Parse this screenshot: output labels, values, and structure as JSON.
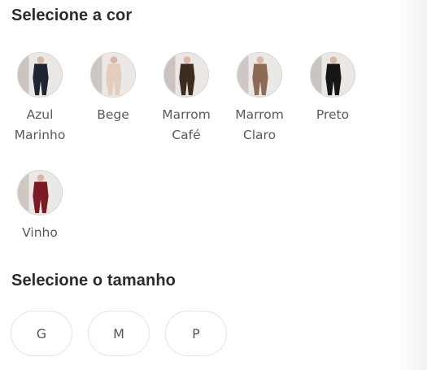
{
  "color_section": {
    "title": "Selecione a cor",
    "options": [
      {
        "label_line1": "Azul",
        "label_line2": "Marinho",
        "outfit_color": "#1e2530",
        "icon": "azul-marinho-outfit-icon"
      },
      {
        "label_line1": "Bege",
        "label_line2": "",
        "outfit_color": "#e3cdbd",
        "icon": "bege-outfit-icon"
      },
      {
        "label_line1": "Marrom",
        "label_line2": "Café",
        "outfit_color": "#3d2b1f",
        "icon": "marrom-cafe-outfit-icon"
      },
      {
        "label_line1": "Marrom",
        "label_line2": "Claro",
        "outfit_color": "#8c6a54",
        "icon": "marrom-claro-outfit-icon"
      },
      {
        "label_line1": "Preto",
        "label_line2": "",
        "outfit_color": "#161616",
        "icon": "preto-outfit-icon"
      },
      {
        "label_line1": "Vinho",
        "label_line2": "",
        "outfit_color": "#7a1a24",
        "icon": "vinho-outfit-icon"
      }
    ]
  },
  "size_section": {
    "title": "Selecione o tamanho",
    "options": [
      "G",
      "M",
      "P"
    ]
  }
}
